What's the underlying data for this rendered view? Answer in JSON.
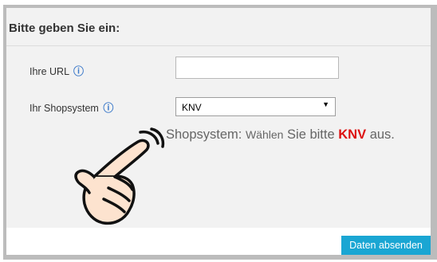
{
  "form": {
    "title": "Bitte geben Sie ein:",
    "url_label": "Ihre URL",
    "url_value": "",
    "shopsystem_label": "Ihr Shopsystem",
    "shopsystem_selected": "KNV",
    "info_icon": "info-icon"
  },
  "hint": {
    "prefix": "Shopsystem:",
    "middle_small": "Wählen",
    "middle": "Sie bitte",
    "highlight": "KNV",
    "suffix": "aus.",
    "highlight_color": "#dd1111"
  },
  "footer": {
    "submit_label": "Daten absenden",
    "submit_color": "#1aa6d3"
  },
  "illustration": {
    "icon": "pointing-hand-icon"
  }
}
